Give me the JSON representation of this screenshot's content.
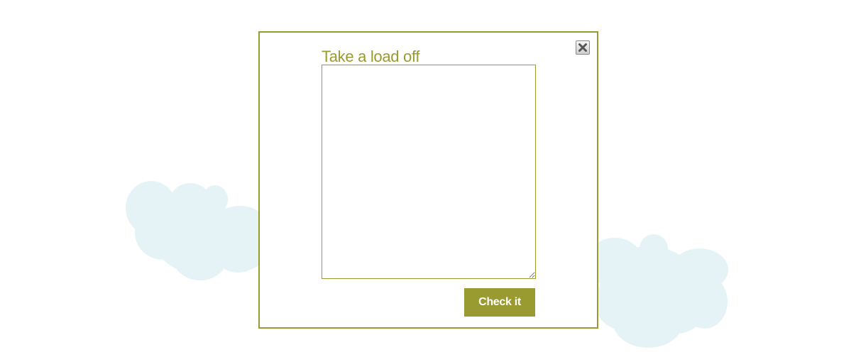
{
  "colors": {
    "accent": "#999a30",
    "cloud": "#e5f3f7",
    "close_icon": "#555555"
  },
  "icons": {
    "close": "close-icon",
    "cloud_left": "cloud-shape",
    "cloud_right": "cloud-shape"
  },
  "dialog": {
    "title": "Take a load off",
    "textarea_value": "",
    "submit_label": "Check it"
  }
}
